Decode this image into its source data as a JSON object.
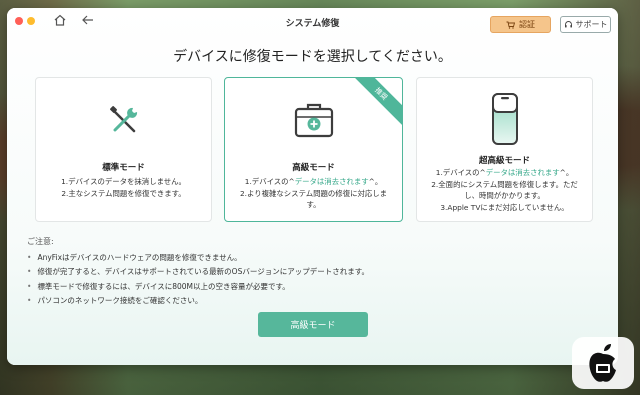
{
  "window": {
    "title": "システム修復",
    "auth_label": "認証",
    "support_label": "サポート"
  },
  "headline": "デバイスに修復モードを選択してください。",
  "modes": [
    {
      "title": "標準モード",
      "desc": [
        "1.デバイスのデータを抹消しません。",
        "2.主なシステム問題を修復できます。"
      ]
    },
    {
      "title": "高級モード",
      "ribbon": "推奨",
      "desc_parts": [
        "1.デバイスの^",
        "データは消去されます",
        "^。"
      ],
      "desc2": "2.より複雑なシステム問題の修復に対応します。"
    },
    {
      "title": "超高級モード",
      "desc_parts": [
        "1.デバイスの^",
        "データは消去されます",
        "^。"
      ],
      "desc2": "2.全面的にシステム問題を修復します。ただし、時間がかかります。",
      "desc3": "3.Apple TVにまだ対応していません。"
    }
  ],
  "notes": {
    "title": "ご注意:",
    "items": [
      "AnyFixはデバイスのハードウェアの問題を修復できません。",
      "修復が完了すると、デバイスはサポートされている最新のOSバージョンにアップデートされます。",
      "標準モードで修復するには、デバイスに800M以上の空き容量が必要です。",
      "パソコンのネットワーク接続をご確認ください。"
    ]
  },
  "action_label": "高級モード",
  "colors": {
    "accent": "#56b79b",
    "highlight": "#36a88a",
    "auth": "#f5c58b"
  }
}
